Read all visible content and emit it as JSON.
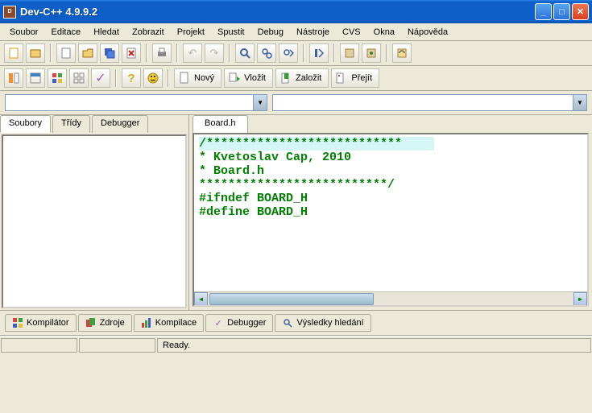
{
  "titlebar": {
    "title": "Dev-C++ 4.9.9.2"
  },
  "menu": {
    "items": [
      "Soubor",
      "Editace",
      "Hledat",
      "Zobrazit",
      "Projekt",
      "Spustit",
      "Debug",
      "Nástroje",
      "CVS",
      "Okna",
      "Nápověda"
    ]
  },
  "toolbar2": {
    "novy": "Nový",
    "vlozit": "Vložit",
    "zalozit": "Založit",
    "prejit": "Přejít"
  },
  "left_tabs": {
    "t0": "Soubory",
    "t1": "Třídy",
    "t2": "Debugger"
  },
  "editor_tab": {
    "name": "Board.h"
  },
  "code": {
    "l1": "/***************************",
    "l2": " * Kvetoslav Cap, 2010",
    "l3": " * Board.h",
    "l4": " **************************/",
    "l5": "",
    "l6": "#ifndef BOARD_H",
    "l7": "#define BOARD_H"
  },
  "bottom_tabs": {
    "t0": "Kompilátor",
    "t1": "Zdroje",
    "t2": "Kompilace",
    "t3": "Debugger",
    "t4": "Výsledky hledání"
  },
  "status": {
    "ready": "Ready."
  }
}
